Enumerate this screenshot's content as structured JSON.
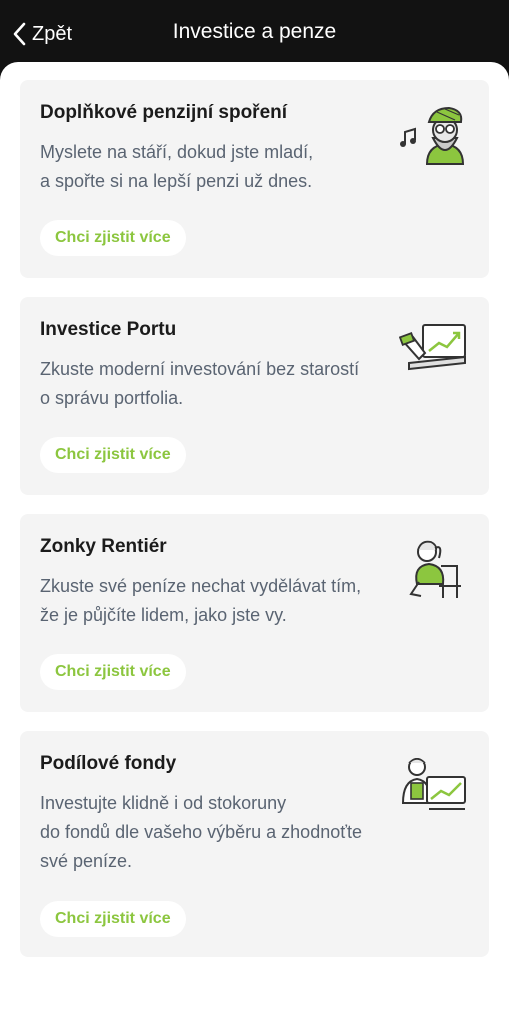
{
  "header": {
    "back_label": "Zpět",
    "title": "Investice a penze"
  },
  "colors": {
    "accent": "#8cc63f",
    "header_bg": "#121212",
    "card_bg": "#f4f4f4",
    "text_muted": "#5a6472"
  },
  "cards": [
    {
      "title": "Doplňkové penzijní spoření",
      "description": [
        "Myslete na stáří, dokud jste mladí,",
        "a spořte si na lepší penzi už dnes."
      ],
      "cta": "Chci zjistit více",
      "illustration": "retired-man-with-music-note"
    },
    {
      "title": "Investice Portu",
      "description": [
        "Zkuste moderní investování bez starostí",
        "o správu portfolia."
      ],
      "cta": "Chci zjistit více",
      "illustration": "laptop-growth-chart"
    },
    {
      "title": "Zonky Rentiér",
      "description": [
        "Zkuste své peníze nechat vydělávat tím,",
        "že je půjčíte lidem, jako jste vy."
      ],
      "cta": "Chci zjistit více",
      "illustration": "person-relaxing-in-chair"
    },
    {
      "title": "Podílové fondy",
      "description": [
        "Investujte klidně i od stokoruny",
        "do fondů dle vašeho výběru a zhodnoťte",
        "své peníze."
      ],
      "cta": "Chci zjistit více",
      "illustration": "person-with-chart-board"
    }
  ]
}
